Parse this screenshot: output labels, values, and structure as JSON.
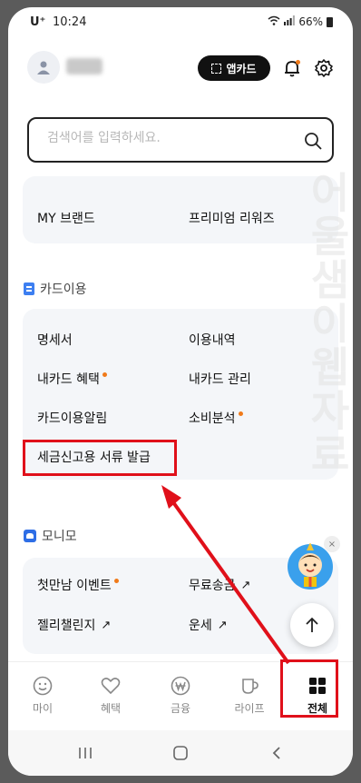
{
  "status_bar": {
    "carrier": "U⁺",
    "time": "10:24",
    "battery": "66%"
  },
  "header": {
    "appcard_label": "앱카드"
  },
  "search": {
    "placeholder": "검색어를 입력하세요."
  },
  "top_card": {
    "items": [
      {
        "label": "MY 브랜드",
        "has_dot": false
      },
      {
        "label": "프리미엄 리워즈",
        "has_dot": false
      }
    ]
  },
  "card_usage": {
    "title": "카드이용",
    "items": [
      {
        "label": "명세서",
        "has_dot": false
      },
      {
        "label": "이용내역",
        "has_dot": false
      },
      {
        "label": "내카드 혜택",
        "has_dot": true
      },
      {
        "label": "내카드 관리",
        "has_dot": false
      },
      {
        "label": "카드이용알림",
        "has_dot": false
      },
      {
        "label": "소비분석",
        "has_dot": true
      },
      {
        "label": "세금신고용 서류 발급",
        "has_dot": false
      }
    ]
  },
  "monimo": {
    "title": "모니모",
    "items": [
      {
        "label": "첫만남 이벤트",
        "has_dot": true,
        "external": false
      },
      {
        "label": "무료송금",
        "has_dot": false,
        "external": true
      },
      {
        "label": "젤리챌린지",
        "has_dot": false,
        "external": true
      },
      {
        "label": "운세",
        "has_dot": false,
        "external": true
      }
    ]
  },
  "watermark": "어울샘이웹자료",
  "tabs": [
    {
      "label": "마이",
      "icon": "smile-icon",
      "active": false
    },
    {
      "label": "혜택",
      "icon": "heart-icon",
      "active": false
    },
    {
      "label": "금융",
      "icon": "won-icon",
      "active": false
    },
    {
      "label": "라이프",
      "icon": "cup-icon",
      "active": false
    },
    {
      "label": "전체",
      "icon": "grid-icon",
      "active": true
    }
  ],
  "colors": {
    "accent_dot": "#f07a1a",
    "annotation": "#e0101a",
    "card_bg": "#f4f6f9",
    "icon_blue": "#3d7ff1"
  }
}
